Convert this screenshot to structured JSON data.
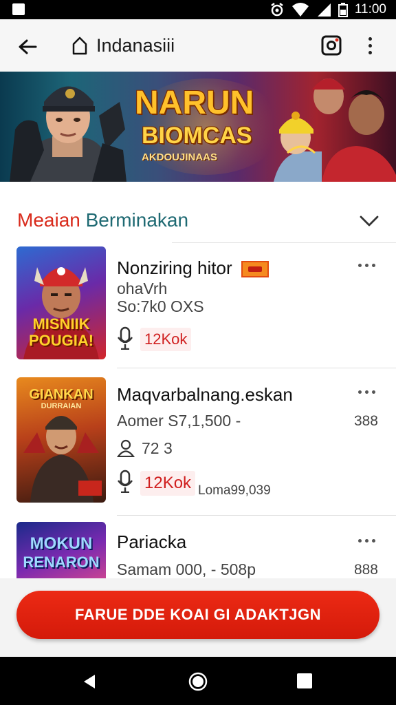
{
  "status_bar": {
    "time": "11:00"
  },
  "app_bar": {
    "title": "Indanasiii"
  },
  "banner": {
    "title": "NARUN",
    "subtitle": "BIOMCAS",
    "tagline": "AKDOUJINAAS"
  },
  "section": {
    "title_part1": "Meaian",
    "title_part2": "Berminakan"
  },
  "items": [
    {
      "name": "Nonziring hitor",
      "line2": "ohaVrh",
      "line3": "So:7k0 OXS",
      "badge": "12Kok",
      "thumb_text_1": "MISNIIK",
      "thumb_text_2": "POUGIA!"
    },
    {
      "name": "Maqvarbalnang.eskan",
      "line2": "Aomer S7,1,500 -",
      "side_value": "388",
      "people": "72 3",
      "badge": "12Kok",
      "extra": "Loma99,039",
      "thumb_text_1": "GIANKAN",
      "thumb_text_2": "DURRAIAN"
    },
    {
      "name": "Pariacka",
      "line2": "Samam 000, - 508p",
      "side_value": "888",
      "thumb_text_1": "MOKUN",
      "thumb_text_2": "RENARON"
    }
  ],
  "cta": {
    "label": "FARUE DDE KOAI GI ADAKTJGN"
  },
  "colors": {
    "accent_red": "#d92b1c",
    "teal": "#1f6a73",
    "cta_red": "#e0220f"
  }
}
